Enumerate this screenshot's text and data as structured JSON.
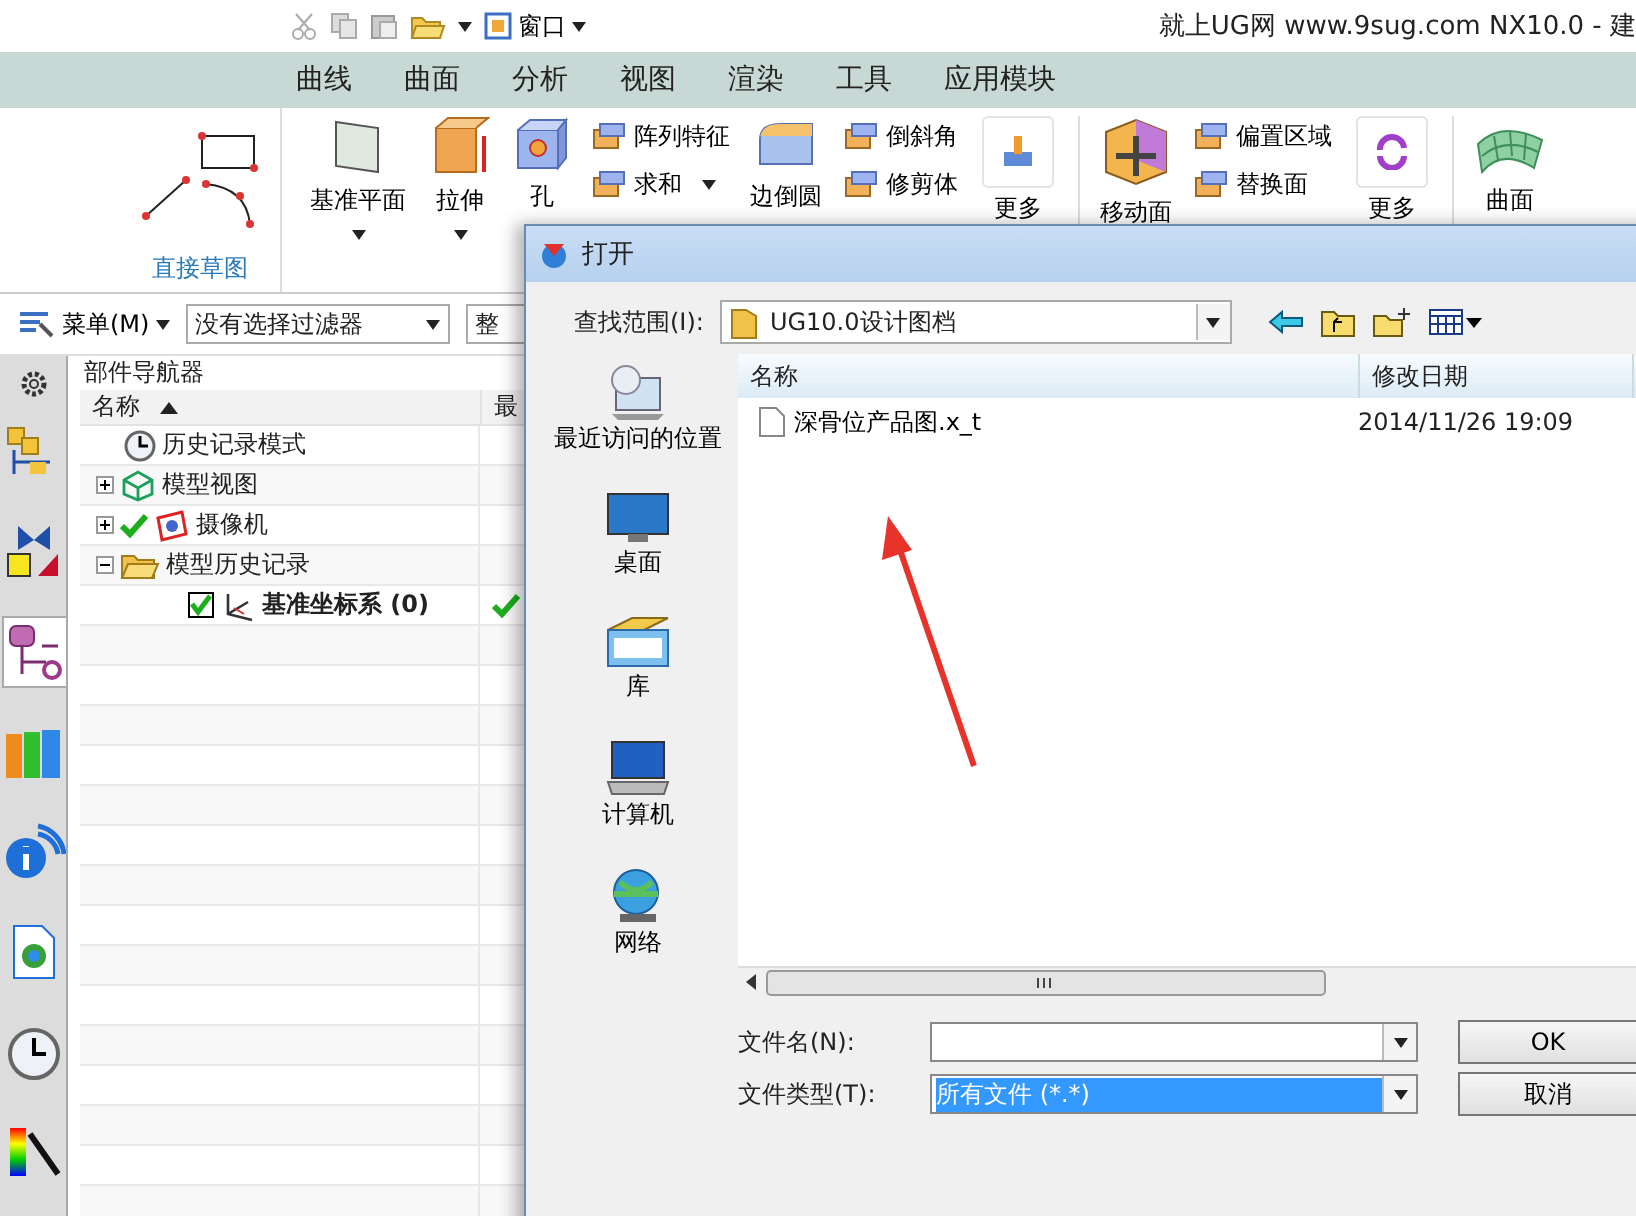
{
  "window": {
    "title": "就上UG网 www.9sug.com NX10.0 - 建",
    "quick_access": {
      "label": "窗口"
    }
  },
  "ribbon": {
    "tabs": [
      {
        "label": "曲线",
        "selected": false
      },
      {
        "label": "曲面",
        "selected": false
      },
      {
        "label": "分析",
        "selected": false
      },
      {
        "label": "视图",
        "selected": false
      },
      {
        "label": "渲染",
        "selected": false
      },
      {
        "label": "工具",
        "selected": false
      },
      {
        "label": "应用模块",
        "selected": false
      }
    ],
    "sketch_group": {
      "label": "直接草图"
    },
    "items": [
      {
        "kind": "large",
        "label": "基准平面",
        "dropdown": true
      },
      {
        "kind": "large",
        "label": "拉伸",
        "dropdown": true
      },
      {
        "kind": "large",
        "label": "孔",
        "dropdown": false
      },
      {
        "kind": "stack",
        "items": [
          {
            "label": "阵列特征",
            "dropdown": false
          },
          {
            "label": "求和",
            "dropdown": true
          }
        ]
      },
      {
        "kind": "large",
        "label": "边倒圆",
        "dropdown": false
      },
      {
        "kind": "stack",
        "items": [
          {
            "label": "倒斜角",
            "dropdown": false
          },
          {
            "label": "修剪体",
            "dropdown": false
          }
        ]
      },
      {
        "kind": "more",
        "label": "更多"
      },
      {
        "kind": "large",
        "label": "移动面",
        "dropdown": false
      },
      {
        "kind": "stack",
        "items": [
          {
            "label": "偏置区域",
            "dropdown": false
          },
          {
            "label": "替换面",
            "dropdown": false
          }
        ]
      },
      {
        "kind": "more",
        "label": "更多"
      },
      {
        "kind": "large",
        "label": "曲面",
        "dropdown": false
      }
    ]
  },
  "toolbar": {
    "menu": {
      "label": "菜单(M)"
    },
    "filter": {
      "value": "没有选择过滤器"
    },
    "scope": {
      "value": "整"
    }
  },
  "resource_tabs": [
    {
      "selected": false
    },
    {
      "selected": false
    },
    {
      "selected": true
    },
    {
      "selected": false
    },
    {
      "selected": false
    },
    {
      "selected": false
    },
    {
      "selected": false
    },
    {
      "selected": false
    }
  ],
  "navigator": {
    "title": "部件导航器",
    "columns": [
      "名称",
      "最"
    ],
    "tree": [
      {
        "label": "历史记录模式",
        "kind": "mode"
      },
      {
        "label": "模型视图",
        "kind": "views",
        "expanded": false
      },
      {
        "label": "摄像机",
        "kind": "camera",
        "expanded": false,
        "checked": true
      },
      {
        "label": "模型历史记录",
        "kind": "folder",
        "expanded": true,
        "children": [
          {
            "label": "基准坐标系 (0)",
            "kind": "datum",
            "checked": true,
            "current": true,
            "up_to_date": true
          }
        ]
      }
    ]
  },
  "dialog": {
    "title": "打开",
    "look_in": {
      "label": "查找范围(I):",
      "value": "UG10.0设计图档"
    },
    "places": [
      "最近访问的位置",
      "桌面",
      "库",
      "计算机",
      "网络"
    ],
    "columns": [
      "名称",
      "修改日期"
    ],
    "files": [
      {
        "name": "深骨位产品图.x_t",
        "modified": "2014/11/26 19:09"
      }
    ],
    "file_name": {
      "label": "文件名(N):"
    },
    "file_type": {
      "label": "文件类型(T):",
      "value": "所有文件 (*.*)",
      "focused": true
    },
    "buttons": [
      "OK",
      "取消"
    ]
  }
}
